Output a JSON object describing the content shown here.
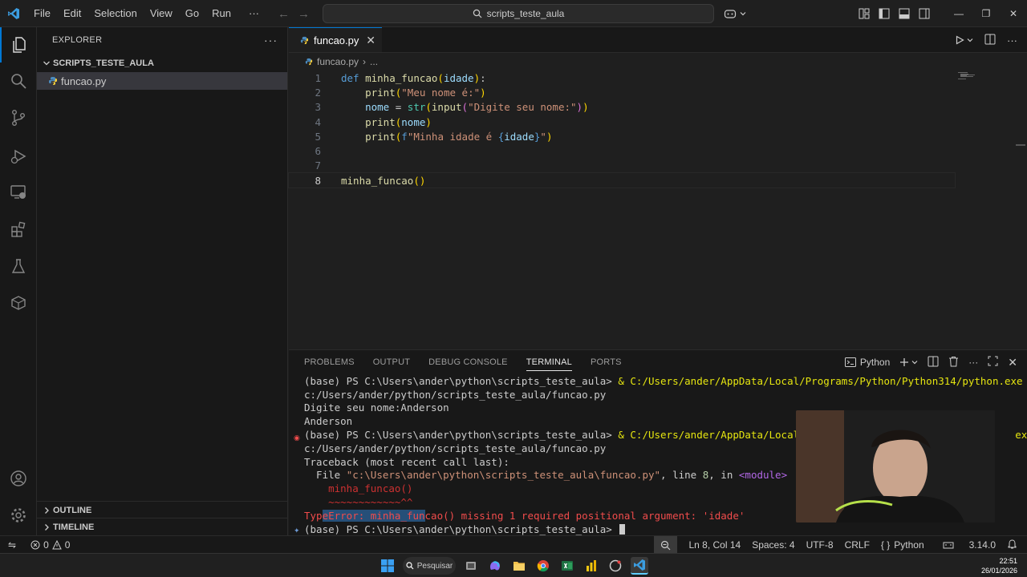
{
  "titlebar": {
    "menu": [
      "File",
      "Edit",
      "Selection",
      "View",
      "Go",
      "Run"
    ],
    "more": "···",
    "search_text": "scripts_teste_aula"
  },
  "sidebar": {
    "header": "EXPLORER",
    "folder": "SCRIPTS_TESTE_AULA",
    "file": "funcao.py",
    "outline": "OUTLINE",
    "timeline": "TIMELINE"
  },
  "editor": {
    "tab_label": "funcao.py",
    "breadcrumb_file": "funcao.py",
    "breadcrumb_more": "...",
    "line_numbers": [
      "1",
      "2",
      "3",
      "4",
      "5",
      "6",
      "7",
      "8"
    ],
    "code": {
      "l1_kw": "def",
      "l1_fn": "minha_funcao",
      "l1_open": "(",
      "l1_param": "idade",
      "l1_close": ")",
      "l1_colon": ":",
      "l2_fn": "print",
      "l2_open": "(",
      "l2_str": "\"Meu nome é:\"",
      "l2_close": ")",
      "l3_var": "nome",
      "l3_eq": " = ",
      "l3_cls": "str",
      "l3_open": "(",
      "l3_fn": "input",
      "l3_open2": "(",
      "l3_str": "\"Digite seu nome:\"",
      "l3_close2": ")",
      "l3_close": ")",
      "l4_fn": "print",
      "l4_open": "(",
      "l4_var": "nome",
      "l4_close": ")",
      "l5_fn": "print",
      "l5_open": "(",
      "l5_f": "f",
      "l5_str1": "\"Minha idade é ",
      "l5_brace1": "{",
      "l5_var": "idade",
      "l5_brace2": "}",
      "l5_str2": "\"",
      "l5_close": ")",
      "l8_fn": "minha_funcao",
      "l8_parens": "()"
    }
  },
  "panel": {
    "tabs": [
      "PROBLEMS",
      "OUTPUT",
      "DEBUG CONSOLE",
      "TERMINAL",
      "PORTS"
    ],
    "active_tab": "TERMINAL",
    "shell_label": "Python",
    "terminal": {
      "l1_prompt": "(base) PS C:\\Users\\ander\\python\\scripts_teste_aula> ",
      "l1_amp": "& ",
      "l1_cmd": "C:/Users/ander/AppData/Local/Programs/Python/Python314/python.exe",
      "l2": "c:/Users/ander/python/scripts_teste_aula/funcao.py",
      "l3": "Digite seu nome:Anderson",
      "l4": "Anderson",
      "l5_prompt": "(base) PS C:\\Users\\ander\\python\\scripts_teste_aula> ",
      "l5_amp": "& ",
      "l5_cmd": "C:/Users/ander/AppData/Local/P",
      "l5_tail": "exe",
      "l6": "c:/Users/ander/python/scripts_teste_aula/funcao.py",
      "l7": "Traceback (most recent call last):",
      "l8_a": "  File ",
      "l8_path": "\"c:\\Users\\ander\\python\\scripts_teste_aula\\funcao.py\"",
      "l8_b": ", line ",
      "l8_num": "8",
      "l8_c": ", in ",
      "l8_mod": "<module>",
      "l9": "    minha_funcao()",
      "l10": "    ~~~~~~~~~~~~^^",
      "l11_a": "Typ",
      "l11_sel": "eError: minha_fun",
      "l11_b": "cao() missing 1 required positional argument: 'idade'",
      "l12": "(base) PS C:\\Users\\ander\\python\\scripts_teste_aula> "
    }
  },
  "statusbar": {
    "errors": "0",
    "warnings": "0",
    "position": "Ln 8, Col 14",
    "spaces": "Spaces: 4",
    "encoding": "UTF-8",
    "eol": "CRLF",
    "language_braces": "{ }",
    "language": "Python",
    "version": "3.14.0"
  },
  "taskbar": {
    "search": "Pesquisar",
    "time": "22:51",
    "date": "26/01/2026"
  },
  "colors": {
    "accent": "#0078d4",
    "error": "#f14c4c"
  }
}
